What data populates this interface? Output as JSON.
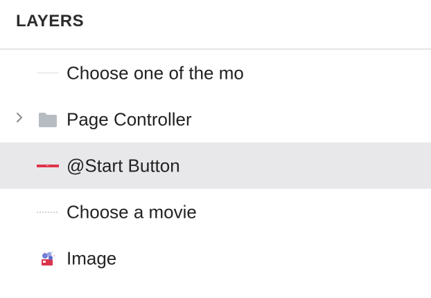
{
  "panel": {
    "title": "LAYERS"
  },
  "layers": [
    {
      "label": "Choose one of the mo",
      "icon": "thin-line-icon",
      "has_chevron": false,
      "selected": false
    },
    {
      "label": "Page Controller",
      "icon": "folder-icon",
      "has_chevron": true,
      "selected": false
    },
    {
      "label": "@Start Button",
      "icon": "red-bar-icon",
      "has_chevron": false,
      "selected": true
    },
    {
      "label": "Choose a movie",
      "icon": "dotted-line-icon",
      "has_chevron": false,
      "selected": false
    },
    {
      "label": "Image",
      "icon": "image-thumbnail-icon",
      "has_chevron": false,
      "selected": false
    }
  ],
  "colors": {
    "selected_row_bg": "#e8e8ea",
    "accent_red": "#e0334a",
    "folder_gray": "#b7bcc2",
    "divider": "#e4e4e4"
  }
}
